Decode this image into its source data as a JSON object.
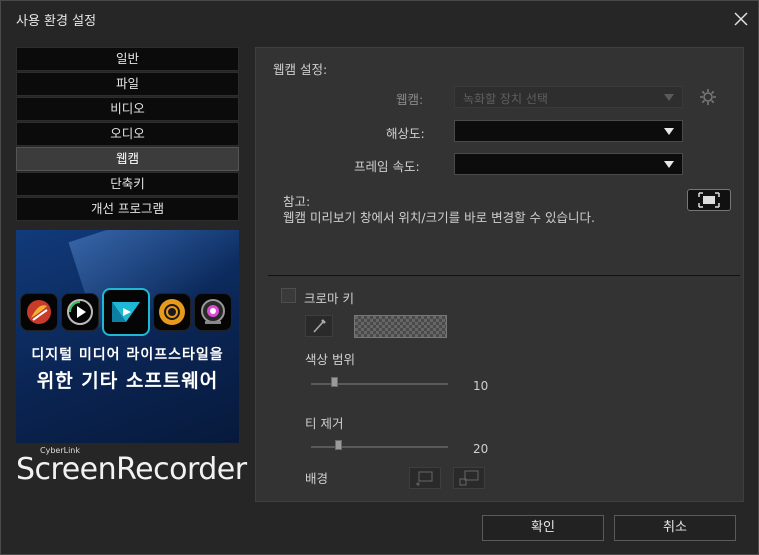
{
  "window": {
    "title": "사용 환경 설정"
  },
  "sidebar": {
    "items": [
      {
        "label": "일반"
      },
      {
        "label": "파일"
      },
      {
        "label": "비디오"
      },
      {
        "label": "오디오"
      },
      {
        "label": "웹캠",
        "active": true
      },
      {
        "label": "단축키"
      },
      {
        "label": "개선 프로그램"
      }
    ]
  },
  "promo": {
    "line1": "디지털 미디어 라이프스타일을",
    "line2": "위한 기타 소프트웨어",
    "brand_small": "CyberLink",
    "brand": "ScreenRecorder",
    "icons": [
      "photodirector-icon",
      "powerdvd-icon",
      "powerdirector-icon",
      "colordirector-icon",
      "youcam-icon"
    ]
  },
  "webcam": {
    "section_title": "웹캠 설정:",
    "webcam_label": "웹캠:",
    "webcam_value": "녹화할 장치 선택",
    "resolution_label": "해상도:",
    "framerate_label": "프레임 속도:",
    "note_title": "참고:",
    "note_text": "웹캠 미리보기 창에서 위치/크기를 바로 변경할 수 있습니다."
  },
  "chroma": {
    "checkbox_label": "크로마 키",
    "color_range_label": "색상 범위",
    "color_range_value": "10",
    "color_range_fraction": 0.17,
    "remove_label": "티 제거",
    "remove_value": "20",
    "remove_fraction": 0.2,
    "background_label": "배경"
  },
  "footer": {
    "ok": "확인",
    "cancel": "취소"
  },
  "colors": {
    "accent": "#1fb7d6",
    "panel": "#333333",
    "window": "#262626"
  }
}
